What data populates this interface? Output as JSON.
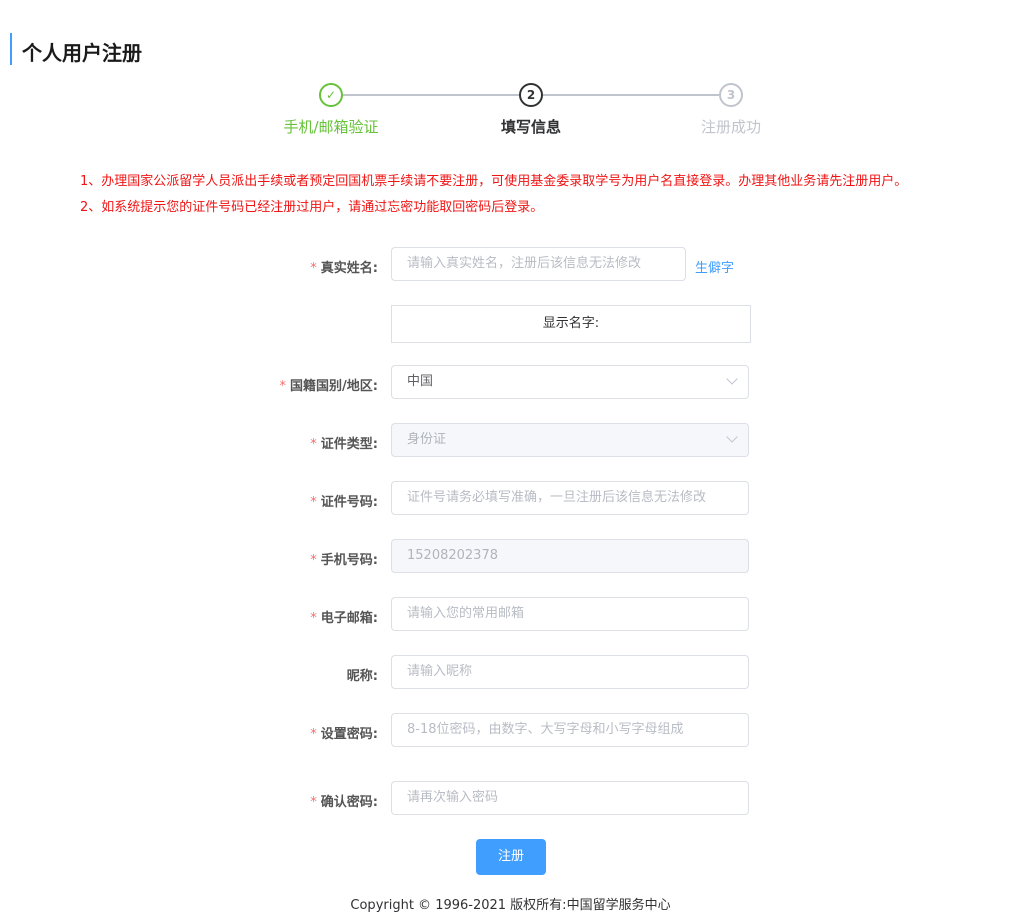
{
  "page": {
    "title": "个人用户注册"
  },
  "steps": [
    {
      "index": "✓",
      "label": "手机/邮箱验证"
    },
    {
      "index": "2",
      "label": "填写信息"
    },
    {
      "index": "3",
      "label": "注册成功"
    }
  ],
  "notices": [
    "1、办理国家公派留学人员派出手续或者预定回国机票手续请不要注册，可使用基金委录取学号为用户名直接登录。办理其他业务请先注册用户。",
    "2、如系统提示您的证件号码已经注册过用户，请通过忘密功能取回密码后登录。"
  ],
  "form": {
    "required_mark": "*",
    "real_name": {
      "label": "真实姓名:",
      "placeholder": "请输入真实姓名，注册后该信息无法修改",
      "link": "生僻字"
    },
    "display_name": {
      "label": "显示名字:"
    },
    "nationality": {
      "label": "国籍国别/地区:",
      "value": "中国"
    },
    "id_type": {
      "label": "证件类型:",
      "value": "身份证"
    },
    "id_number": {
      "label": "证件号码:",
      "placeholder": "证件号请务必填写准确，一旦注册后该信息无法修改"
    },
    "phone": {
      "label": "手机号码:",
      "value": "15208202378"
    },
    "email": {
      "label": "电子邮箱:",
      "placeholder": "请输入您的常用邮箱"
    },
    "nickname": {
      "label": "昵称:",
      "placeholder": "请输入昵称"
    },
    "password": {
      "label": "设置密码:",
      "placeholder": "8-18位密码，由数字、大写字母和小写字母组成"
    },
    "confirm_password": {
      "label": "确认密码:",
      "placeholder": "请再次输入密码"
    },
    "submit_label": "注册"
  },
  "footer": {
    "copyright": "Copyright © 1996-2021 版权所有:中国留学服务中心"
  }
}
